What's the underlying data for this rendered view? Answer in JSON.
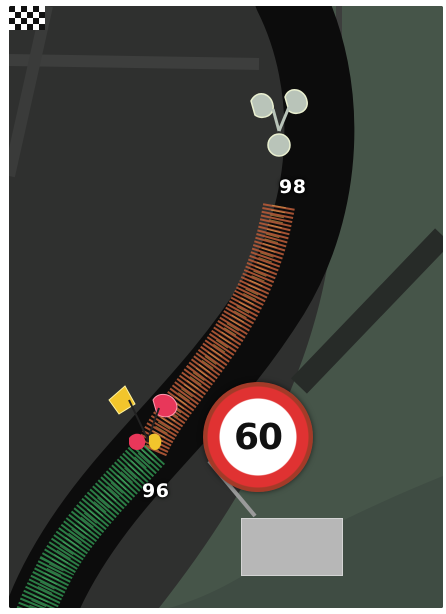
{
  "map": {
    "route_waypoints": [
      {
        "label": "98",
        "icon": "pin-flag-icon",
        "color": "#b9c4b9"
      },
      {
        "label": "96",
        "icon": "flag-cluster-icon",
        "colors": [
          "#f2c52c",
          "#e8375a"
        ]
      }
    ],
    "speed_limit": {
      "value": "60",
      "unit_icon": "speed-limit-sign-icon",
      "ring_color": "#e03232"
    },
    "destination": {
      "icon": "checkered-flag-icon"
    },
    "colors": {
      "road": "#0f0f0f",
      "terrain": "#4a5a4c",
      "background": "#2f302f",
      "route_ahead": "#2f8a4a",
      "route_warning": "#c96a3b"
    }
  }
}
